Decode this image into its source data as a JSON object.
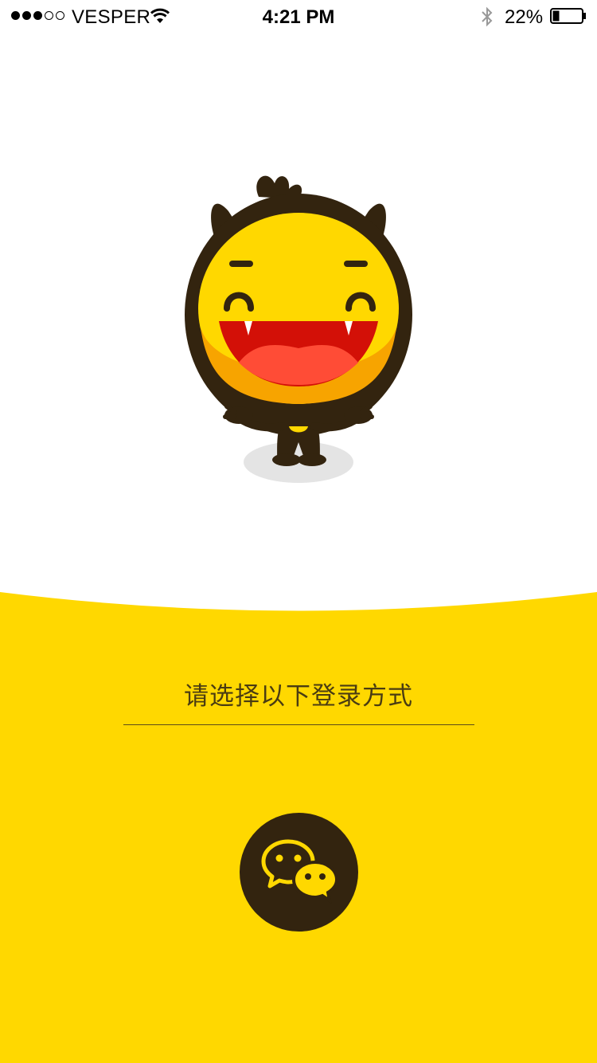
{
  "status_bar": {
    "carrier": "VESPER",
    "time": "4:21 PM",
    "battery_percent": "22%",
    "signal_bars_filled": 3,
    "signal_bars_total": 5,
    "battery_level": 0.22,
    "icons": [
      "wifi-icon",
      "bluetooth-icon",
      "battery-icon"
    ]
  },
  "mascot": {
    "icon": "laughing-mascot-illustration"
  },
  "login": {
    "prompt": "请选择以下登录方式",
    "wechat_icon": "wechat-icon"
  },
  "colors": {
    "brand_yellow": "#FFD800",
    "dark_brown": "#33240F",
    "text_brown": "#4A3C12"
  }
}
